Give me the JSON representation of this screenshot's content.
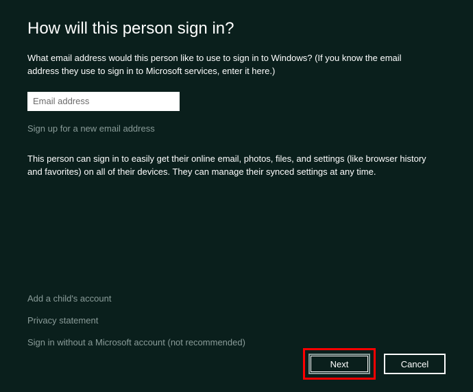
{
  "title": "How will this person sign in?",
  "description": "What email address would this person like to use to sign in to Windows? (If you know the email address they use to sign in to Microsoft services, enter it here.)",
  "email": {
    "placeholder": "Email address",
    "value": ""
  },
  "signup_link": "Sign up for a new email address",
  "info_text": "This person can sign in to easily get their online email, photos, files, and settings (like browser history and favorites) on all of their devices. They can manage their synced settings at any time.",
  "bottom_links": {
    "child_account": "Add a child's account",
    "privacy": "Privacy statement",
    "no_msaccount": "Sign in without a Microsoft account (not recommended)"
  },
  "buttons": {
    "next": "Next",
    "cancel": "Cancel"
  }
}
